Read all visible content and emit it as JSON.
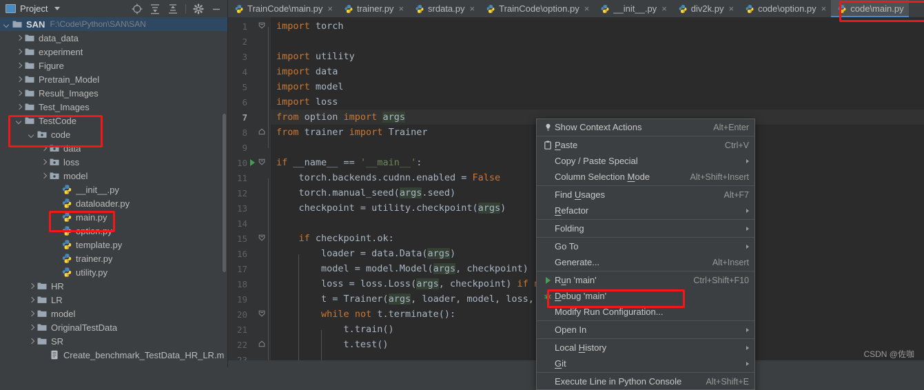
{
  "project_panel": {
    "title": "Project",
    "title_icon": "project-window-icon",
    "dropdown_icon": "chevron-down-icon",
    "tools": [
      {
        "name": "locate-in-tree-icon",
        "label": "Select Opened File"
      },
      {
        "name": "expand-all-icon",
        "label": "Expand All"
      },
      {
        "name": "collapse-all-icon",
        "label": "Collapse All"
      },
      {
        "name": "gear-icon",
        "label": "Options"
      },
      {
        "name": "minimize-icon",
        "label": "Hide"
      }
    ],
    "root": {
      "label": "SAN",
      "path": "F:\\Code\\Python\\SAN\\SAN",
      "expanded": true,
      "selected": true
    },
    "items": [
      {
        "label": "data_data",
        "indent": 1,
        "kind": "folder",
        "state": "closed",
        "highlight": false
      },
      {
        "label": "experiment",
        "indent": 1,
        "kind": "folder",
        "state": "closed",
        "highlight": false
      },
      {
        "label": "Figure",
        "indent": 1,
        "kind": "folder",
        "state": "closed",
        "highlight": false
      },
      {
        "label": "Pretrain_Model",
        "indent": 1,
        "kind": "folder",
        "state": "closed",
        "highlight": false
      },
      {
        "label": "Result_Images",
        "indent": 1,
        "kind": "folder",
        "state": "closed",
        "highlight": false
      },
      {
        "label": "Test_Images",
        "indent": 1,
        "kind": "folder",
        "state": "closed",
        "highlight": false
      },
      {
        "label": "TestCode",
        "indent": 1,
        "kind": "folder",
        "state": "open",
        "highlight": true
      },
      {
        "label": "code",
        "indent": 2,
        "kind": "package",
        "state": "open",
        "highlight": true
      },
      {
        "label": "data",
        "indent": 3,
        "kind": "package",
        "state": "closed",
        "highlight": false
      },
      {
        "label": "loss",
        "indent": 3,
        "kind": "package",
        "state": "closed",
        "highlight": false
      },
      {
        "label": "model",
        "indent": 3,
        "kind": "package",
        "state": "closed",
        "highlight": false
      },
      {
        "label": "__init__.py",
        "indent": 4,
        "kind": "python",
        "state": "none",
        "highlight": false
      },
      {
        "label": "dataloader.py",
        "indent": 4,
        "kind": "python",
        "state": "none",
        "highlight": false
      },
      {
        "label": "main.py",
        "indent": 4,
        "kind": "python",
        "state": "none",
        "highlight": true
      },
      {
        "label": "option.py",
        "indent": 4,
        "kind": "python",
        "state": "none",
        "highlight": false
      },
      {
        "label": "template.py",
        "indent": 4,
        "kind": "python",
        "state": "none",
        "highlight": false
      },
      {
        "label": "trainer.py",
        "indent": 4,
        "kind": "python",
        "state": "none",
        "highlight": false
      },
      {
        "label": "utility.py",
        "indent": 4,
        "kind": "python",
        "state": "none",
        "highlight": false
      },
      {
        "label": "HR",
        "indent": 2,
        "kind": "folder",
        "state": "closed",
        "highlight": false
      },
      {
        "label": "LR",
        "indent": 2,
        "kind": "folder",
        "state": "closed",
        "highlight": false
      },
      {
        "label": "model",
        "indent": 2,
        "kind": "folder",
        "state": "closed",
        "highlight": false
      },
      {
        "label": "OriginalTestData",
        "indent": 2,
        "kind": "folder",
        "state": "closed",
        "highlight": false
      },
      {
        "label": "SR",
        "indent": 2,
        "kind": "folder",
        "state": "closed",
        "highlight": false
      },
      {
        "label": "Create_benchmark_TestData_HR_LR.m",
        "indent": 3,
        "kind": "mfile",
        "state": "none",
        "highlight": false
      }
    ]
  },
  "tabs": [
    {
      "label": "TrainCode\\main.py",
      "active": false,
      "icon": "python-file-icon",
      "close_glyph": "×"
    },
    {
      "label": "trainer.py",
      "active": false,
      "icon": "python-file-icon",
      "close_glyph": "×"
    },
    {
      "label": "srdata.py",
      "active": false,
      "icon": "python-file-icon",
      "close_glyph": "×"
    },
    {
      "label": "TrainCode\\option.py",
      "active": false,
      "icon": "python-file-icon",
      "close_glyph": "×"
    },
    {
      "label": "__init__.py",
      "active": false,
      "icon": "python-file-icon",
      "close_glyph": "×"
    },
    {
      "label": "div2k.py",
      "active": false,
      "icon": "python-file-icon",
      "close_glyph": "×"
    },
    {
      "label": "code\\option.py",
      "active": false,
      "icon": "python-file-icon",
      "close_glyph": "×"
    },
    {
      "label": "code\\main.py",
      "active": true,
      "icon": "python-file-icon",
      "close_glyph": "×"
    }
  ],
  "editor": {
    "current_line": 7,
    "run_marker_line": 10,
    "lines": [
      {
        "n": 1,
        "text": "import torch",
        "fold": "start"
      },
      {
        "n": 2,
        "text": ""
      },
      {
        "n": 3,
        "text": "import utility"
      },
      {
        "n": 4,
        "text": "import data"
      },
      {
        "n": 5,
        "text": "import model"
      },
      {
        "n": 6,
        "text": "import loss"
      },
      {
        "n": 7,
        "text": "from option import args"
      },
      {
        "n": 8,
        "text": "from trainer import Trainer",
        "fold": "end"
      },
      {
        "n": 9,
        "text": ""
      },
      {
        "n": 10,
        "text": "if __name__ == '__main__':",
        "fold": "start"
      },
      {
        "n": 11,
        "text": "    torch.backends.cudnn.enabled = False"
      },
      {
        "n": 12,
        "text": "    torch.manual_seed(args.seed)"
      },
      {
        "n": 13,
        "text": "    checkpoint = utility.checkpoint(args)"
      },
      {
        "n": 14,
        "text": ""
      },
      {
        "n": 15,
        "text": "    if checkpoint.ok:",
        "fold": "start"
      },
      {
        "n": 16,
        "text": "        loader = data.Data(args)"
      },
      {
        "n": 17,
        "text": "        model = model.Model(args, checkpoint)"
      },
      {
        "n": 18,
        "text": "        loss = loss.Loss(args, checkpoint) if not args.test_onl"
      },
      {
        "n": 19,
        "text": "        t = Trainer(args, loader, model, loss, checkpoint)"
      },
      {
        "n": 20,
        "text": "        while not t.terminate():",
        "fold": "start"
      },
      {
        "n": 21,
        "text": "            t.train()"
      },
      {
        "n": 22,
        "text": "            t.test()",
        "fold": "end"
      },
      {
        "n": 23,
        "text": ""
      }
    ]
  },
  "context_menu": {
    "items": [
      {
        "label": "Show Context Actions",
        "mnemonic": "",
        "shortcut": "Alt+Enter",
        "icon": "lightbulb-icon",
        "submenu": false,
        "separator_after": true,
        "highlight": false
      },
      {
        "label": "Paste",
        "mnemonic": "P",
        "shortcut": "Ctrl+V",
        "icon": "clipboard-icon",
        "submenu": false,
        "separator_after": false,
        "highlight": false
      },
      {
        "label": "Copy / Paste Special",
        "mnemonic": "",
        "shortcut": "",
        "icon": "",
        "submenu": true,
        "separator_after": false,
        "highlight": false
      },
      {
        "label": "Column Selection Mode",
        "mnemonic": "M",
        "shortcut": "Alt+Shift+Insert",
        "icon": "",
        "submenu": false,
        "separator_after": true,
        "highlight": false
      },
      {
        "label": "Find Usages",
        "mnemonic": "U",
        "shortcut": "Alt+F7",
        "icon": "",
        "submenu": false,
        "separator_after": false,
        "highlight": false
      },
      {
        "label": "Refactor",
        "mnemonic": "R",
        "shortcut": "",
        "icon": "",
        "submenu": true,
        "separator_after": true,
        "highlight": false
      },
      {
        "label": "Folding",
        "mnemonic": "",
        "shortcut": "",
        "icon": "",
        "submenu": true,
        "separator_after": true,
        "highlight": false
      },
      {
        "label": "Go To",
        "mnemonic": "",
        "shortcut": "",
        "icon": "",
        "submenu": true,
        "separator_after": false,
        "highlight": false
      },
      {
        "label": "Generate...",
        "mnemonic": "",
        "shortcut": "Alt+Insert",
        "icon": "",
        "submenu": false,
        "separator_after": true,
        "highlight": false
      },
      {
        "label": "Run 'main'",
        "mnemonic": "u",
        "shortcut": "Ctrl+Shift+F10",
        "icon": "run-icon",
        "submenu": false,
        "separator_after": false,
        "highlight": false
      },
      {
        "label": "Debug 'main'",
        "mnemonic": "D",
        "shortcut": "",
        "icon": "debug-icon",
        "submenu": false,
        "separator_after": false,
        "highlight": false
      },
      {
        "label": "Modify Run Configuration...",
        "mnemonic": "",
        "shortcut": "",
        "icon": "",
        "submenu": false,
        "separator_after": true,
        "highlight": true
      },
      {
        "label": "Open In",
        "mnemonic": "",
        "shortcut": "",
        "icon": "",
        "submenu": true,
        "separator_after": true,
        "highlight": false
      },
      {
        "label": "Local History",
        "mnemonic": "H",
        "shortcut": "",
        "icon": "",
        "submenu": true,
        "separator_after": false,
        "highlight": false
      },
      {
        "label": "Git",
        "mnemonic": "G",
        "shortcut": "",
        "icon": "",
        "submenu": true,
        "separator_after": true,
        "highlight": false
      },
      {
        "label": "Execute Line in Python Console",
        "mnemonic": "",
        "shortcut": "Alt+Shift+E",
        "icon": "",
        "submenu": false,
        "separator_after": false,
        "highlight": false
      }
    ]
  },
  "watermark": "CSDN @佐咖",
  "colors": {
    "panel_bg": "#3c3f41",
    "editor_bg": "#2b2b2b",
    "gutter_bg": "#313335",
    "selection_bg": "#2f4862",
    "accent_blue": "#4a88c7",
    "highlight_red": "#f01818",
    "keyword_orange": "#cc7832",
    "string_green": "#6a8759",
    "text_default": "#a9b7c6",
    "occurrence_hl": "#344134"
  }
}
